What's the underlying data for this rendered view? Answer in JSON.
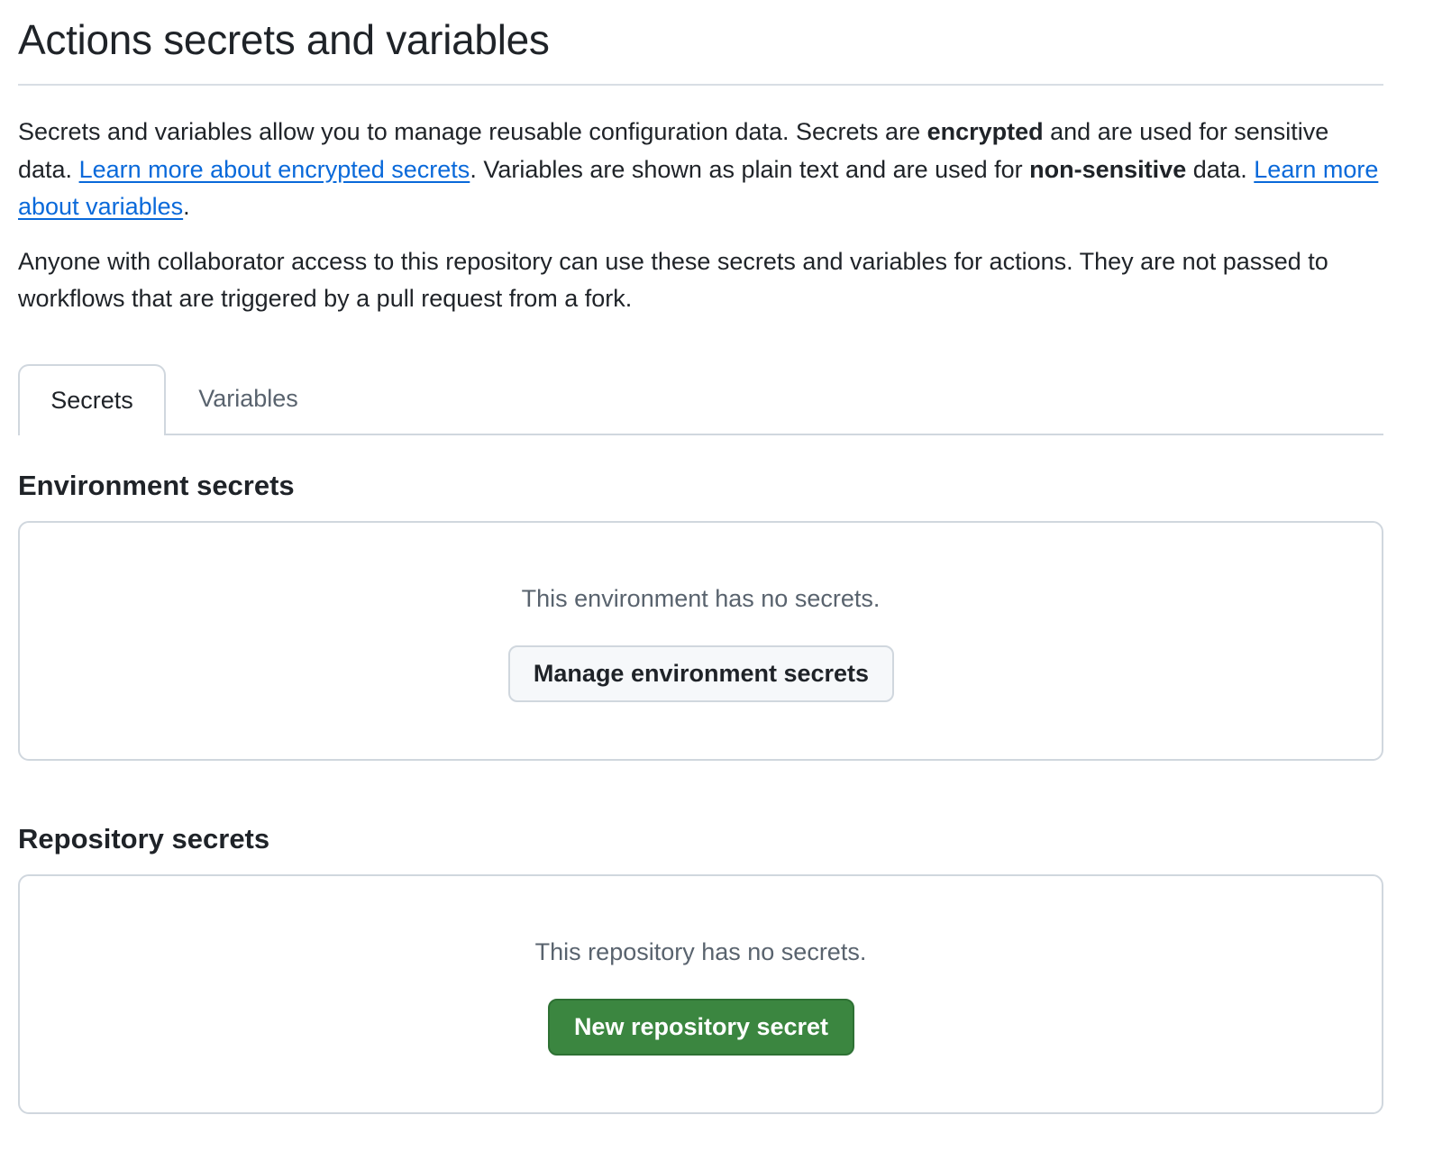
{
  "page": {
    "title": "Actions secrets and variables"
  },
  "intro": {
    "part1": "Secrets and variables allow you to manage reusable configuration data. Secrets are ",
    "bold1": "encrypted",
    "part2": " and are used for sensitive data. ",
    "link1": "Learn more about encrypted secrets",
    "part3": ". Variables are shown as plain text and are used for ",
    "bold2": "non-sensitive",
    "part4": " data. ",
    "link2": "Learn more about variables",
    "part5": "."
  },
  "access_note": "Anyone with collaborator access to this repository can use these secrets and variables for actions. They are not passed to workflows that are triggered by a pull request from a fork.",
  "tabs": [
    {
      "label": "Secrets",
      "selected": true
    },
    {
      "label": "Variables",
      "selected": false
    }
  ],
  "environment_secrets": {
    "heading": "Environment secrets",
    "empty_text": "This environment has no secrets.",
    "button_label": "Manage environment secrets"
  },
  "repository_secrets": {
    "heading": "Repository secrets",
    "empty_text": "This repository has no secrets.",
    "button_label": "New repository secret"
  },
  "colors": {
    "link": "#0969da",
    "primary_button": "#3b8640",
    "muted_text": "#59636e",
    "border": "#d0d7de"
  }
}
